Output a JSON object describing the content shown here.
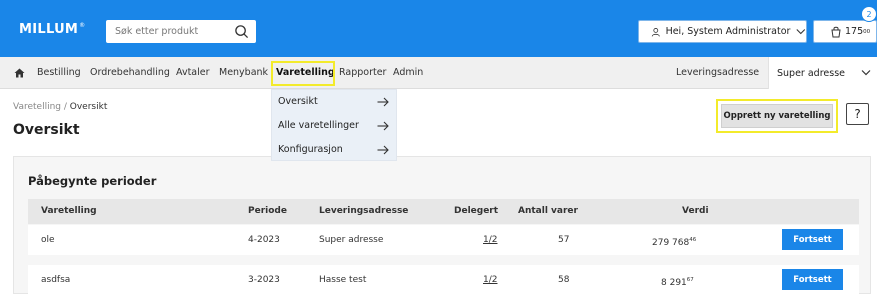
{
  "colors": {
    "primary": "#1a86e8",
    "highlight": "#f3eb2b"
  },
  "header": {
    "logo": "MILLUM",
    "logo_mark": "®",
    "search_placeholder": "Søk etter produkt",
    "user_label": "Hei, System Administrator",
    "cart_amount": "175",
    "cart_cents": "00",
    "cart_badge": "2",
    "icons": [
      "search-icon",
      "user-icon",
      "chevron-down-icon",
      "cart-icon"
    ]
  },
  "nav": {
    "items": [
      "Bestilling",
      "Ordrebehandling",
      "Avtaler",
      "Menybank",
      "Varetelling",
      "Rapporter",
      "Admin"
    ],
    "active": "Varetelling",
    "delivery_label": "Leveringsadresse",
    "delivery_value": "Super adresse"
  },
  "dropdown": {
    "items": [
      "Oversikt",
      "Alle varetellinger",
      "Konfigurasjon"
    ]
  },
  "breadcrumb": {
    "parent": "Varetelling",
    "separator": " / ",
    "current": "Oversikt"
  },
  "page": {
    "title": "Oversikt",
    "new_count_label": "Opprett ny varetelling",
    "help_label": "?"
  },
  "table": {
    "title": "Påbegynte perioder",
    "columns": [
      "Varetelling",
      "Periode",
      "Leveringsadresse",
      "Delegert",
      "Antall varer",
      "Verdi"
    ],
    "action_label": "Fortsett",
    "rows": [
      {
        "name": "ole",
        "period": "4-2023",
        "address": "Super adresse",
        "delegated": "1/2",
        "count": "57",
        "value": "279 768",
        "value_cents": "46"
      },
      {
        "name": "asdfsa",
        "period": "3-2023",
        "address": "Hasse test",
        "delegated": "1/2",
        "count": "58",
        "value": "8 291",
        "value_cents": "67"
      }
    ]
  }
}
